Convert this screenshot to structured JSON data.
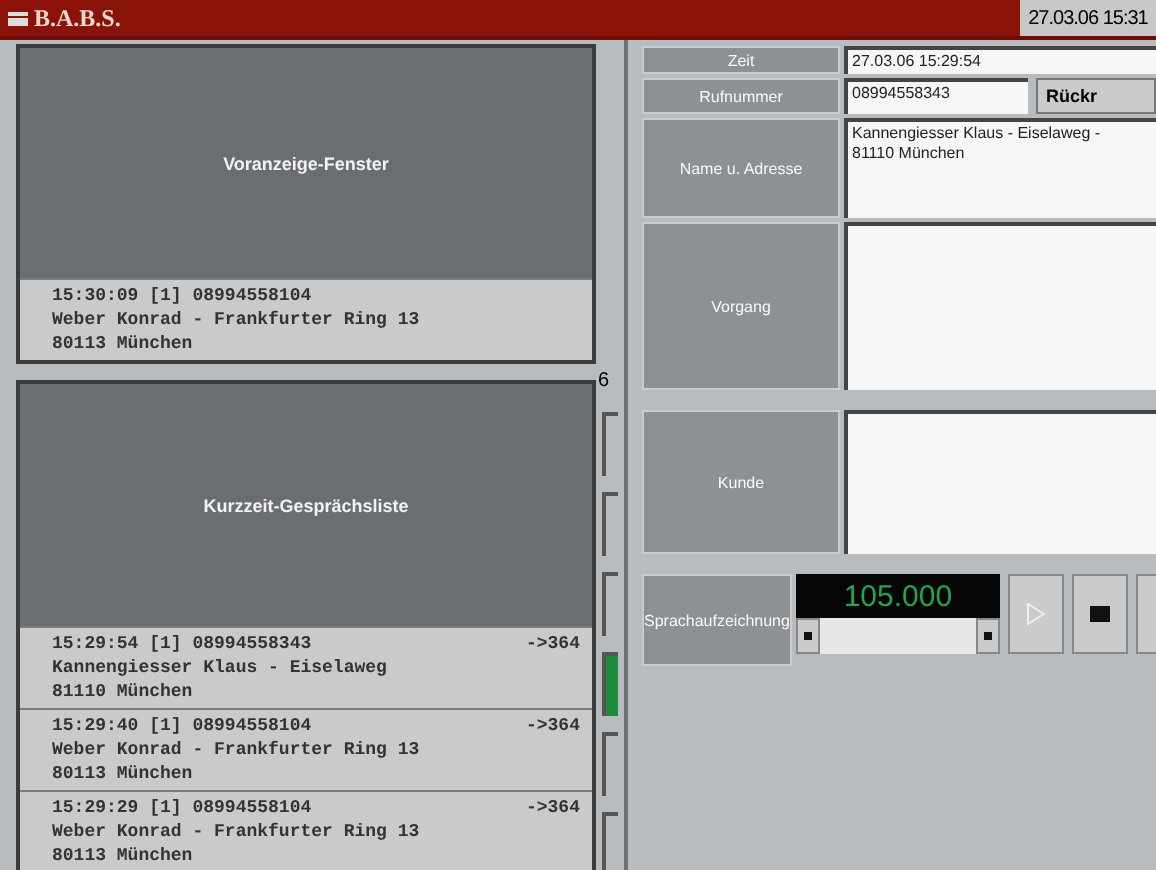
{
  "window": {
    "title": "B.A.B.S.",
    "clock": "27.03.06 15:31"
  },
  "preview": {
    "title": "Voranzeige-Fenster",
    "entry": {
      "line1": "15:30:09 [1] 08994558104",
      "line2": "Weber Konrad - Frankfurter Ring 13",
      "line3": "80113 München"
    },
    "count": "6"
  },
  "call_list": {
    "title": "Kurzzeit-Gesprächsliste",
    "entries": [
      {
        "line1": "15:29:54 [1] 08994558343",
        "target": "->364",
        "line2": "Kannengiesser Klaus - Eiselaweg",
        "line3": "81110 München"
      },
      {
        "line1": "15:29:40 [1] 08994558104",
        "target": "->364",
        "line2": "Weber Konrad - Frankfurter Ring 13",
        "line3": "80113 München"
      },
      {
        "line1": "15:29:29 [1] 08994558104",
        "target": "->364",
        "line2": "Weber Konrad - Frankfurter Ring 13",
        "line3": "80113 München"
      }
    ]
  },
  "indicators": [
    {
      "on": false
    },
    {
      "on": false
    },
    {
      "on": false
    },
    {
      "on": true
    },
    {
      "on": false
    },
    {
      "on": false
    }
  ],
  "form": {
    "rows": [
      {
        "kind": "line",
        "label": "Zeit",
        "value": "27.03.06 15:29:54"
      },
      {
        "kind": "button",
        "label": "Rufnummer",
        "value": "08994558343",
        "button": "Rückr"
      },
      {
        "kind": "text",
        "label": "Name u. Adresse",
        "value": "Kannengiesser Klaus - Eiselaweg -\n81110 München"
      },
      {
        "kind": "area",
        "label": "Vorgang",
        "value": ""
      },
      {
        "kind": "area",
        "label": "Kunde",
        "value": ""
      }
    ]
  },
  "recording": {
    "label": "Sprachaufzeichnung",
    "display": "105.000"
  }
}
